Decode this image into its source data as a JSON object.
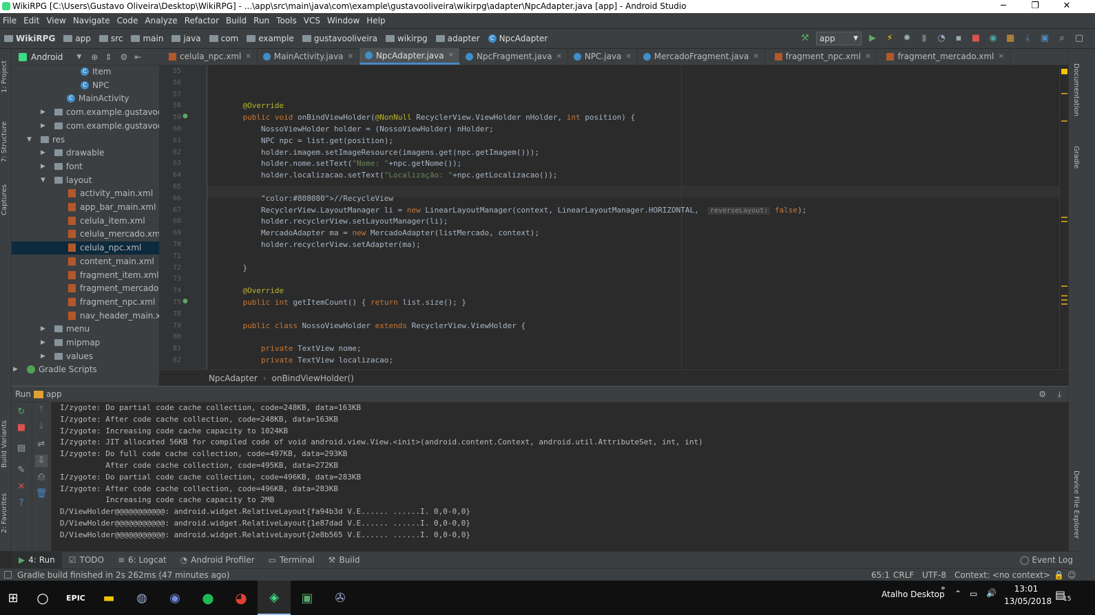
{
  "window": {
    "title": "WikiRPG [C:\\Users\\Gustavo Oliveira\\Desktop\\WikiRPG] - ...\\app\\src\\main\\java\\com\\example\\gustavooliveira\\wikirpg\\adapter\\NpcAdapter.java [app] - Android Studio",
    "minimize": "─",
    "maximize": "❐",
    "close": "✕"
  },
  "menu": [
    "File",
    "Edit",
    "View",
    "Navigate",
    "Code",
    "Analyze",
    "Refactor",
    "Build",
    "Run",
    "Tools",
    "VCS",
    "Window",
    "Help"
  ],
  "breadcrumbs": [
    "WikiRPG",
    "app",
    "src",
    "main",
    "java",
    "com",
    "example",
    "gustavooliveira",
    "wikirpg",
    "adapter",
    "NpcAdapter"
  ],
  "run_config": "app",
  "project_panel": {
    "view": "Android",
    "rows": [
      {
        "label": "Item",
        "indent": 100,
        "icon": "class",
        "arrow": ""
      },
      {
        "label": "NPC",
        "indent": 100,
        "icon": "class",
        "arrow": ""
      },
      {
        "label": "MainActivity",
        "indent": 80,
        "icon": "class",
        "arrow": ""
      },
      {
        "label": "com.example.gustavooliv",
        "indent": 62,
        "icon": "folder",
        "arrow": "▶"
      },
      {
        "label": "com.example.gustavooliv",
        "indent": 62,
        "icon": "folder",
        "arrow": "▶"
      },
      {
        "label": "res",
        "indent": 42,
        "icon": "folder",
        "arrow": "▼"
      },
      {
        "label": "drawable",
        "indent": 62,
        "icon": "folder",
        "arrow": "▶"
      },
      {
        "label": "font",
        "indent": 62,
        "icon": "folder",
        "arrow": "▶"
      },
      {
        "label": "layout",
        "indent": 62,
        "icon": "folder",
        "arrow": "▼"
      },
      {
        "label": "activity_main.xml",
        "indent": 82,
        "icon": "xml",
        "arrow": ""
      },
      {
        "label": "app_bar_main.xml",
        "indent": 82,
        "icon": "xml",
        "arrow": ""
      },
      {
        "label": "celula_item.xml",
        "indent": 82,
        "icon": "xml",
        "arrow": ""
      },
      {
        "label": "celula_mercado.xml",
        "indent": 82,
        "icon": "xml",
        "arrow": ""
      },
      {
        "label": "celula_npc.xml",
        "indent": 82,
        "icon": "xml",
        "arrow": "",
        "selected": true
      },
      {
        "label": "content_main.xml",
        "indent": 82,
        "icon": "xml",
        "arrow": ""
      },
      {
        "label": "fragment_item.xml",
        "indent": 82,
        "icon": "xml",
        "arrow": ""
      },
      {
        "label": "fragment_mercado.xn",
        "indent": 82,
        "icon": "xml",
        "arrow": ""
      },
      {
        "label": "fragment_npc.xml",
        "indent": 82,
        "icon": "xml",
        "arrow": ""
      },
      {
        "label": "nav_header_main.xml",
        "indent": 82,
        "icon": "xml",
        "arrow": ""
      },
      {
        "label": "menu",
        "indent": 62,
        "icon": "folder",
        "arrow": "▶"
      },
      {
        "label": "mipmap",
        "indent": 62,
        "icon": "folder",
        "arrow": "▶"
      },
      {
        "label": "values",
        "indent": 62,
        "icon": "folder",
        "arrow": "▶"
      },
      {
        "label": "Gradle Scripts",
        "indent": 22,
        "icon": "gradle",
        "arrow": "▶"
      }
    ]
  },
  "tabs": [
    {
      "label": "celula_npc.xml",
      "type": "xml"
    },
    {
      "label": "MainActivity.java",
      "type": "class"
    },
    {
      "label": "NpcAdapter.java",
      "type": "class",
      "active": true
    },
    {
      "label": "NpcFragment.java",
      "type": "class"
    },
    {
      "label": "NPC.java",
      "type": "class"
    },
    {
      "label": "MercadoFragment.java",
      "type": "class"
    },
    {
      "label": "fragment_npc.xml",
      "type": "xml"
    },
    {
      "label": "fragment_mercado.xml",
      "type": "xml"
    }
  ],
  "editor": {
    "lines": [
      {
        "n": "55",
        "code": ""
      },
      {
        "n": "56",
        "code": ""
      },
      {
        "n": "57",
        "code": ""
      },
      {
        "n": "58",
        "code": "    @Override"
      },
      {
        "n": "59",
        "code": "    public void onBindViewHolder(@NonNull RecyclerView.ViewHolder nHolder, int position) {"
      },
      {
        "n": "60",
        "code": "        NossoViewHolder holder = (NossoViewHolder) nHolder;"
      },
      {
        "n": "61",
        "code": "        NPC npc = list.get(position);"
      },
      {
        "n": "62",
        "code": "        holder.imagem.setImageResource(imagens.get(npc.getImagem()));"
      },
      {
        "n": "63",
        "code": "        holder.nome.setText(\"Nome: \"+npc.getNome());"
      },
      {
        "n": "64",
        "code": "        holder.localizacao.setText(\"Localização: \"+npc.getLocalizacao());"
      },
      {
        "n": "65",
        "code": ""
      },
      {
        "n": "66",
        "code": "        //RecycleView"
      },
      {
        "n": "67",
        "code": "        RecyclerView.LayoutManager li = new LinearLayoutManager(context, LinearLayoutManager.HORIZONTAL,  reverseLayout: false);"
      },
      {
        "n": "68",
        "code": "        holder.recyclerView.setLayoutManager(li);"
      },
      {
        "n": "69",
        "code": "        MercadoAdapter ma = new MercadoAdapter(listMercado, context);"
      },
      {
        "n": "70",
        "code": "        holder.recyclerView.setAdapter(ma);"
      },
      {
        "n": "71",
        "code": ""
      },
      {
        "n": "72",
        "code": "    }"
      },
      {
        "n": "73",
        "code": ""
      },
      {
        "n": "74",
        "code": "    @Override"
      },
      {
        "n": "75",
        "code": "    public int getItemCount() { return list.size(); }"
      },
      {
        "n": "78",
        "code": ""
      },
      {
        "n": "79",
        "code": "    public class NossoViewHolder extends RecyclerView.ViewHolder {"
      },
      {
        "n": "80",
        "code": ""
      },
      {
        "n": "81",
        "code": "        private TextView nome;"
      },
      {
        "n": "82",
        "code": "        private TextView localizacao;"
      }
    ]
  },
  "editor_breadcrumb": [
    "NpcAdapter",
    "onBindViewHolder()"
  ],
  "run_panel": {
    "title": "Run",
    "config": "app",
    "log": [
      "I/zygote: Do partial code cache collection, code=248KB, data=163KB",
      "I/zygote: After code cache collection, code=248KB, data=163KB",
      "I/zygote: Increasing code cache capacity to 1024KB",
      "I/zygote: JIT allocated 56KB for compiled code of void android.view.View.<init>(android.content.Context, android.util.AttributeSet, int, int)",
      "I/zygote: Do full code cache collection, code=497KB, data=293KB",
      "          After code cache collection, code=495KB, data=272KB",
      "I/zygote: Do partial code cache collection, code=496KB, data=283KB",
      "I/zygote: After code cache collection, code=496KB, data=283KB",
      "          Increasing code cache capacity to 2MB",
      "D/ViewHolder@@@@@@@@@@@: android.widget.RelativeLayout{fa94b3d V.E...... ......I. 0,0-0,0}",
      "D/ViewHolder@@@@@@@@@@@: android.widget.RelativeLayout{1e87dad V.E...... ......I. 0,0-0,0}",
      "D/ViewHolder@@@@@@@@@@@: android.widget.RelativeLayout{2e8b565 V.E...... ......I. 0,0-0,0}"
    ]
  },
  "bottom_tools": [
    "4: Run",
    "TODO",
    "6: Logcat",
    "Android Profiler",
    "Terminal",
    "Build"
  ],
  "event_log": "Event Log",
  "status": {
    "message": "Gradle build finished in 2s 262ms (47 minutes ago)",
    "position": "65:1",
    "line_sep": "CRLF",
    "encoding": "UTF-8",
    "context": "Context: <no context>"
  },
  "side_tabs": {
    "left": [
      "1: Project",
      "7: Structure",
      "Captures",
      "Build Variants",
      "2: Favorites"
    ],
    "right": [
      "Documentation",
      "Gradle",
      "Device File Explorer"
    ]
  },
  "taskbar": {
    "desktop": "Atalho Desktop",
    "time": "13:01",
    "date": "13/05/2018",
    "notif": "15"
  }
}
